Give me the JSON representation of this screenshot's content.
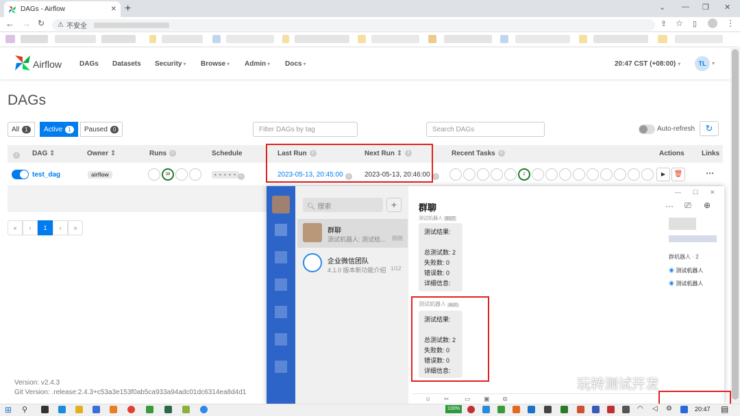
{
  "browser": {
    "tab_title": "DAGs - Airflow",
    "new_tab": "+",
    "address_security": "不安全",
    "window_controls": [
      "minimize",
      "restore",
      "close"
    ]
  },
  "navbar": {
    "brand": "Airflow",
    "items": [
      {
        "label": "DAGs",
        "dropdown": false
      },
      {
        "label": "Datasets",
        "dropdown": false
      },
      {
        "label": "Security",
        "dropdown": true
      },
      {
        "label": "Browse",
        "dropdown": true
      },
      {
        "label": "Admin",
        "dropdown": true
      },
      {
        "label": "Docs",
        "dropdown": true
      }
    ],
    "clock": "20:47 CST (+08:00)",
    "user_initials": "TL"
  },
  "page": {
    "title": "DAGs",
    "filters": {
      "all_label": "All",
      "all_count": "1",
      "active_label": "Active",
      "active_count": "1",
      "paused_label": "Paused",
      "paused_count": "0"
    },
    "tag_filter_placeholder": "Filter DAGs by tag",
    "search_placeholder": "Search DAGs",
    "auto_refresh_label": "Auto-refresh",
    "refresh_icon": "refresh-icon"
  },
  "table": {
    "headers": {
      "dag": "DAG",
      "owner": "Owner",
      "runs": "Runs",
      "schedule": "Schedule",
      "last_run": "Last Run",
      "next_run": "Next Run",
      "recent_tasks": "Recent Tasks",
      "actions": "Actions",
      "links": "Links"
    },
    "rows": [
      {
        "dag_id": "test_dag",
        "owner": "airflow",
        "runs_success": "38",
        "schedule": "• • • • •",
        "last_run": "2023-05-13, 20:45:00",
        "next_run": "2023-05-13, 20:46:00",
        "recent_tasks_success": "2",
        "links_menu": "⋯"
      }
    ]
  },
  "pagination": {
    "first": "«",
    "prev": "‹",
    "current": "1",
    "next": "›",
    "last": "»"
  },
  "footer": {
    "version": "Version: v2.4.3",
    "git_version": "Git Version: .release:2.4.3+c53a3e153f0ab5ca933a94adc01dc6314ea8d4d1"
  },
  "wecom": {
    "search_placeholder": "搜索",
    "plus": "+",
    "chats": [
      {
        "name": "群聊",
        "preview": "测试机器人: 测试结...",
        "time": "刚刚"
      },
      {
        "name": "企业微信团队",
        "preview": "4.1.0 版本新功能介绍",
        "time": "1/12"
      }
    ],
    "chat_title": "群聊",
    "more": "···",
    "messages": [
      {
        "sender": "测试机器人",
        "badge": "BOT",
        "lines": [
          "测试结果:",
          "",
          "总测试数: 2",
          "失败数: 0",
          "错误数: 0",
          "详细信息:"
        ]
      },
      {
        "sender": "测试机器人",
        "badge": "BOT",
        "lines": [
          "测试结果:",
          "",
          "总测试数: 2",
          "失败数: 0",
          "错误数: 0",
          "详细信息:"
        ]
      }
    ],
    "members_label": "群机器人 · 2",
    "bots": [
      "测试机器人",
      "测试机器人"
    ]
  },
  "taskbar": {
    "battery": "100%",
    "time": "20:47"
  },
  "watermark": "玩转测试开发",
  "colors": {
    "accent": "#017cee",
    "success": "#1a7a2a",
    "highlight_box": "#e02020",
    "wecom_sidebar": "#2d64c8"
  }
}
